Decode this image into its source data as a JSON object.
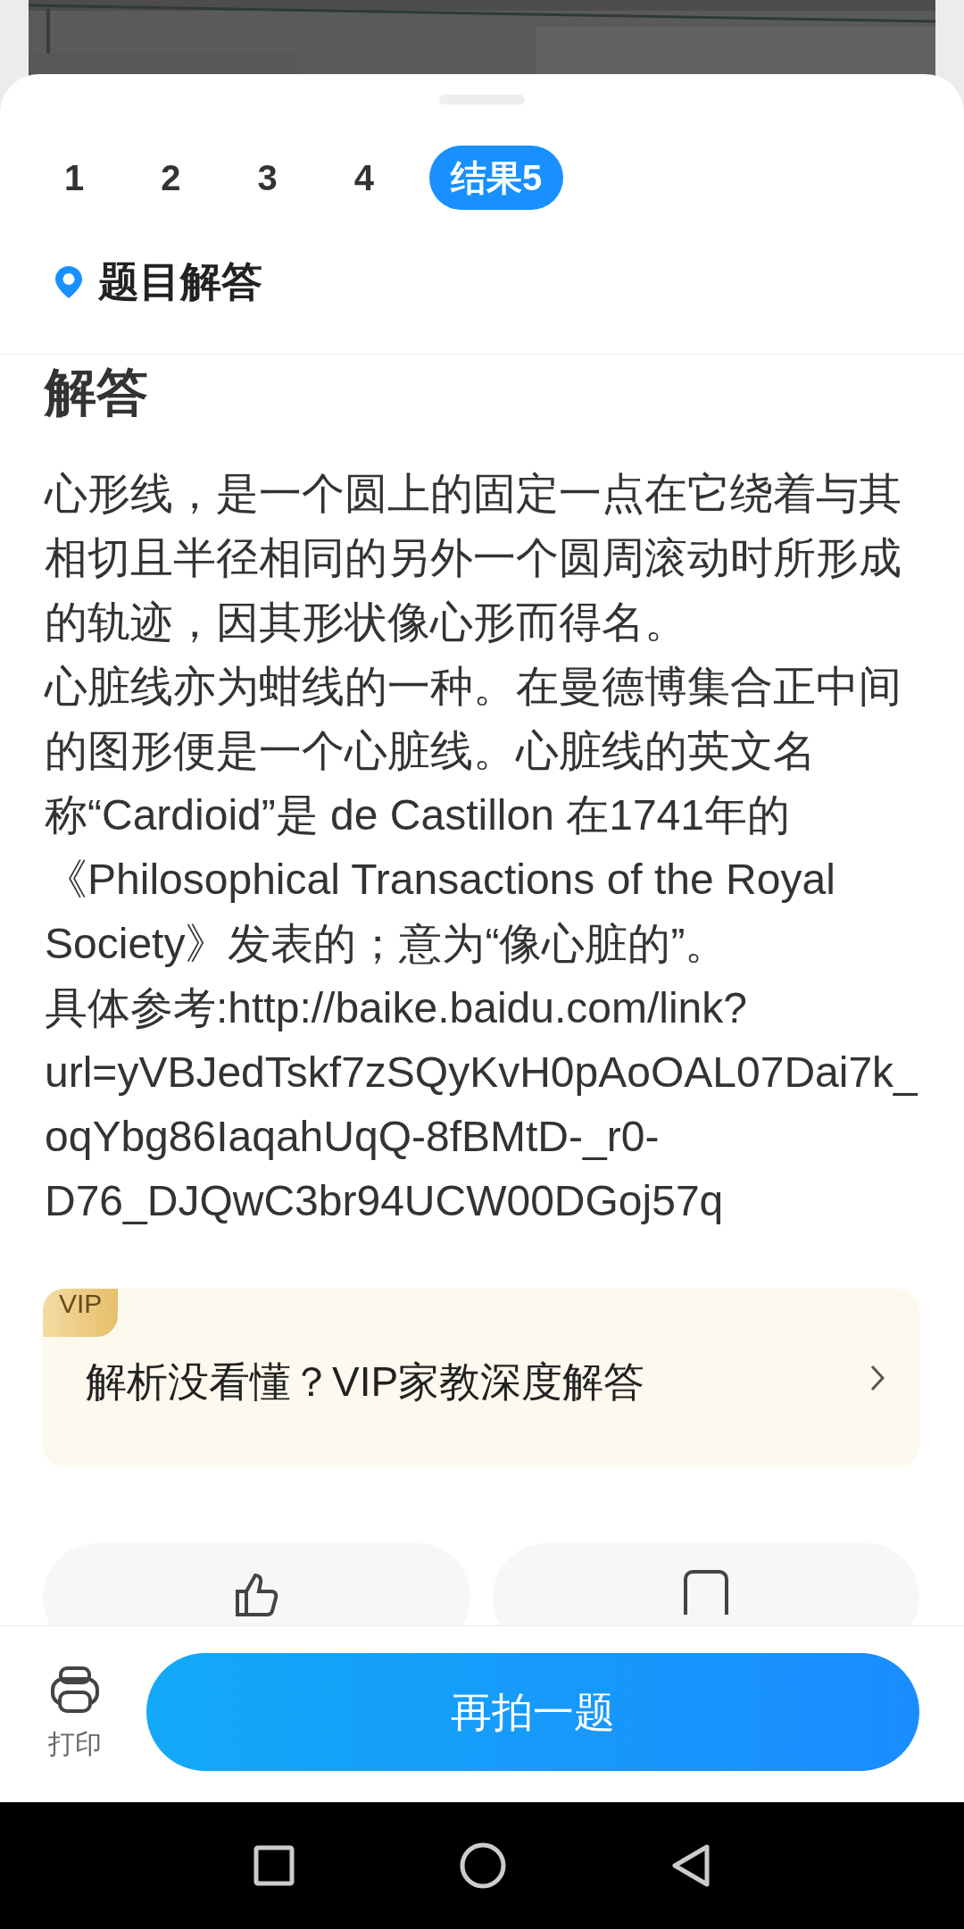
{
  "tabs": [
    {
      "label": "1",
      "selected": false
    },
    {
      "label": "2",
      "selected": false
    },
    {
      "label": "3",
      "selected": false
    },
    {
      "label": "4",
      "selected": false
    },
    {
      "label": "结果5",
      "selected": true
    }
  ],
  "section_title": "题目解答",
  "answer": {
    "heading": "解答",
    "paragraphs": [
      "心形线，是一个圆上的固定一点在它绕着与其相切且半径相同的另外一个圆周滚动时所形成的轨迹，因其形状像心形而得名。",
      "心脏线亦为蚶线的一种。在曼德博集合正中间的图形便是一个心脏线。心脏线的英文名称“Cardioid”是 de Castillon 在1741年的《Philosophical Transactions of the Royal Society》发表的；意为“像心脏的”。",
      "具体参考:http://baike.baidu.com/link?url=yVBJedTskf7zSQyKvH0pAoOAL07Dai7k_oqYbg86IaqahUqQ-8fBMtD-_r0-D76_DJQwC3br94UCW00DGoj57q"
    ]
  },
  "vip_card": {
    "badge": "VIP",
    "text": "解析没看懂？VIP家教深度解答"
  },
  "bottom_bar": {
    "print_label": "打印",
    "primary_button": "再拍一题"
  }
}
